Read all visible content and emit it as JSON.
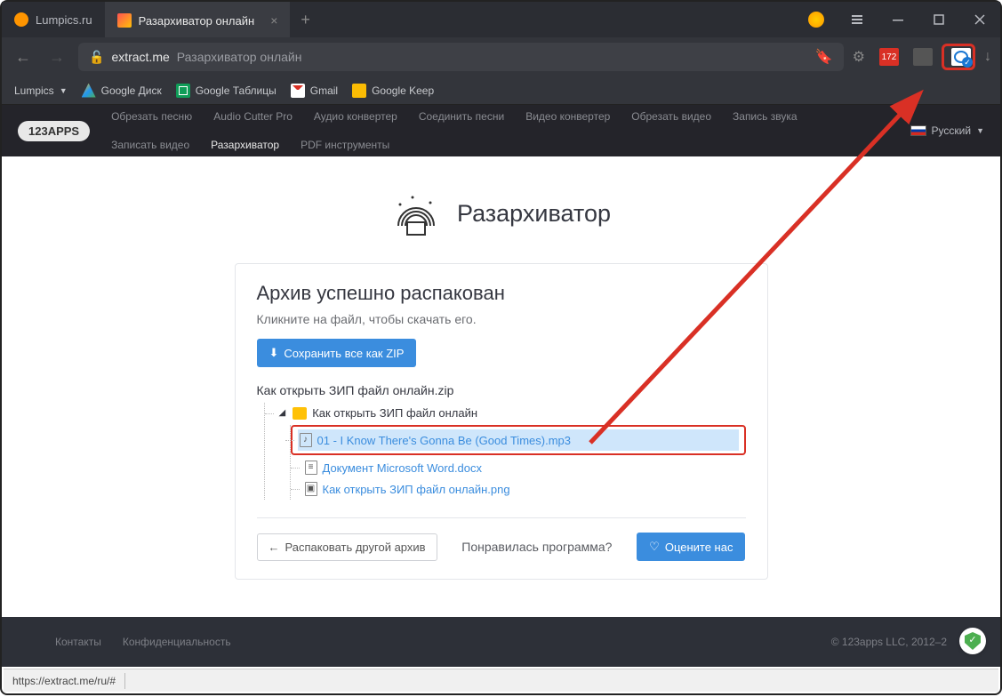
{
  "tabs": [
    {
      "label": "Lumpics.ru"
    },
    {
      "label": "Разархиватор онлайн"
    }
  ],
  "address": {
    "domain": "extract.me",
    "title": "Разархиватор онлайн"
  },
  "ext_badge": "172",
  "bookmarks": [
    {
      "label": "Lumpics",
      "type": "folder"
    },
    {
      "label": "Google Диск",
      "type": "triangle"
    },
    {
      "label": "Google Таблицы",
      "type": "sheets"
    },
    {
      "label": "Gmail",
      "type": "gmail"
    },
    {
      "label": "Google Keep",
      "type": "keep"
    }
  ],
  "appsnav_logo": "123APPS",
  "appsnav_links": [
    "Обрезать песню",
    "Audio Cutter Pro",
    "Аудио конвертер",
    "Соединить песни",
    "Видео конвертер",
    "Обрезать видео",
    "Запись звука",
    "Записать видео",
    "Разархиватор",
    "PDF инструменты"
  ],
  "appsnav_active_index": 8,
  "lang_label": "Русский",
  "page": {
    "title": "Разархиватор",
    "success_h": "Архив успешно распакован",
    "success_sub": "Кликните на файл, чтобы скачать его.",
    "save_all": "Сохранить все как ZIP",
    "zip_name": "Как открыть ЗИП файл онлайн.zip",
    "folder": "Как открыть ЗИП файл онлайн",
    "files": [
      "01 - I Know There's Gonna Be (Good Times).mp3",
      "Документ Microsoft Word.docx",
      "Как открыть ЗИП файл онлайн.png"
    ],
    "unpack_another": "Распаковать другой архив",
    "like_q": "Понравилась программа?",
    "rate_us": "Оцените нас"
  },
  "footer": {
    "links": [
      "Контакты",
      "Конфиденциальность"
    ],
    "copyright": "© 123apps LLC, 2012–2"
  },
  "status_url": "https://extract.me/ru/#"
}
